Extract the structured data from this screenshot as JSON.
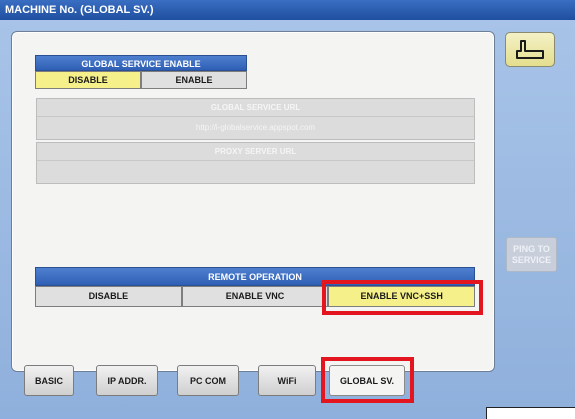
{
  "window": {
    "title": "MACHINE No. (GLOBAL SV.)"
  },
  "back_button": {
    "icon": "return-arrow-icon"
  },
  "global_service_enable": {
    "header": "GLOBAL SERVICE ENABLE",
    "options": [
      "DISABLE",
      "ENABLE"
    ],
    "selected": "DISABLE"
  },
  "global_service_url": {
    "title": "GLOBAL SERVICE URL",
    "value": "http://i-globalservice.appspot.com"
  },
  "proxy_server_url": {
    "title": "PROXY SERVER URL",
    "value": ""
  },
  "ping_button": {
    "label": "PING TO\nSERVICE",
    "enabled": false
  },
  "remote_operation": {
    "header": "REMOTE OPERATION",
    "options": [
      "DISABLE",
      "ENABLE VNC",
      "ENABLE VNC+SSH"
    ],
    "selected": "ENABLE VNC+SSH"
  },
  "tabs": [
    "BASIC",
    "IP ADDR.",
    "PC COM",
    "WiFi",
    "GLOBAL SV."
  ],
  "active_tab": "GLOBAL SV.",
  "colors": {
    "title_bar": "#2a5fb5",
    "section_header": "#3c6cc2",
    "selected_option": "#f5f08a",
    "highlight": "#e3151f",
    "background": "#9dbbe3"
  }
}
